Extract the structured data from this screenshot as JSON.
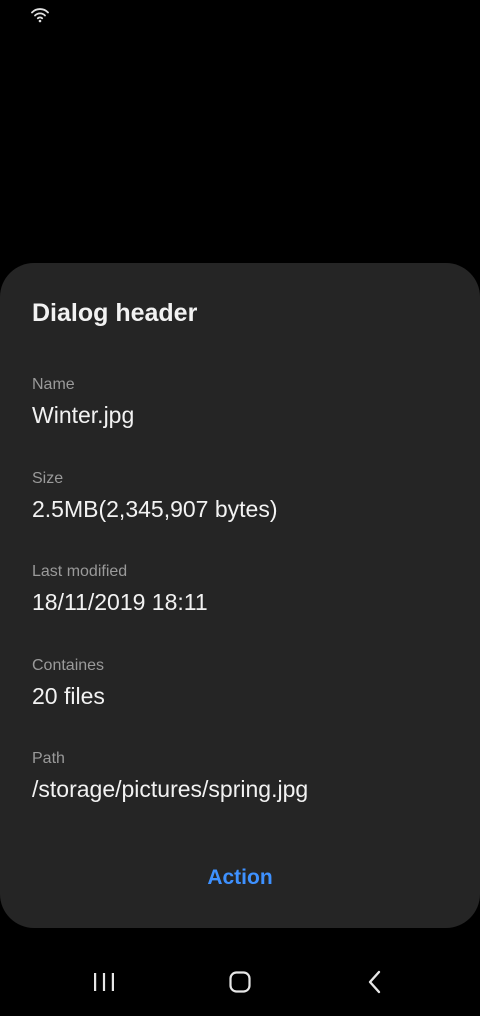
{
  "status_bar": {
    "icons": [
      "wifi-icon"
    ]
  },
  "dialog": {
    "title": "Dialog header",
    "fields": [
      {
        "label": "Name",
        "value": "Winter.jpg"
      },
      {
        "label": "Size",
        "value": "2.5MB(2,345,907 bytes)"
      },
      {
        "label": "Last modified",
        "value": "18/11/2019 18:11"
      },
      {
        "label": "Containes",
        "value": "20 files"
      },
      {
        "label": "Path",
        "value": "/storage/pictures/spring.jpg"
      }
    ],
    "action_label": "Action"
  },
  "nav_bar": {
    "buttons": [
      "recents-icon",
      "home-icon",
      "back-icon"
    ]
  },
  "colors": {
    "background": "#000000",
    "dialog_background": "#252525",
    "text_primary": "#f2f2f2",
    "text_secondary": "#9a9a9a",
    "accent": "#3e91ff"
  }
}
